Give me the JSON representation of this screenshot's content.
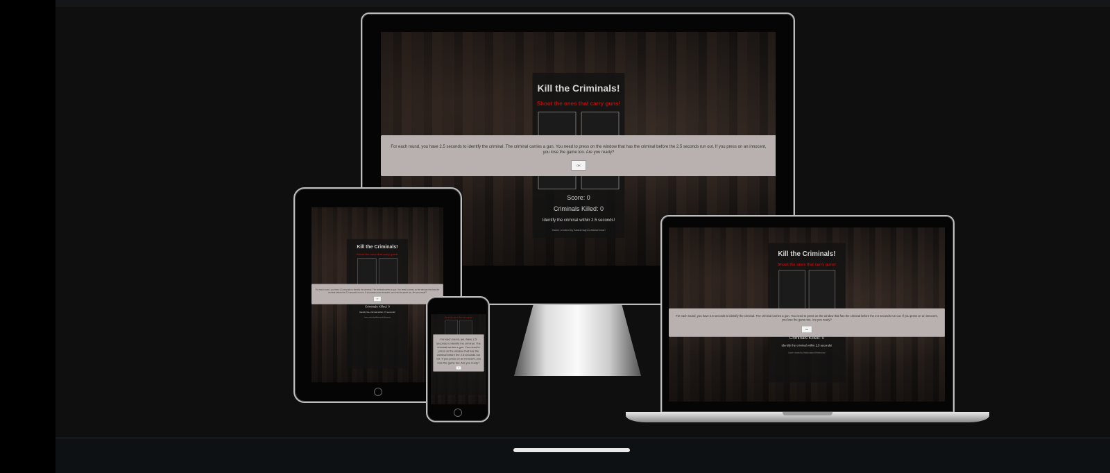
{
  "game": {
    "title": "Kill the Criminals!",
    "subtitle": "Shoot the ones that carry guns!",
    "score": "Score: 0",
    "killed": "Criminals Killed: 0",
    "hint": "Identify the criminal within 2.5 seconds!",
    "credit": "Game created by Abdulmajeed Alshammari",
    "modal_text": "For each round, you have 2.5 seconds to identify the criminal. The criminal carries a gun. You need to press on the window that has the criminal before the 2.5 seconds run out. If you press on an innocent, you lose the game too. Are you ready?",
    "ok_label": "OK"
  },
  "colors": {
    "accent_red": "#b01010",
    "modal_bg": "#b8b1af",
    "panel_bg": "#121212"
  }
}
